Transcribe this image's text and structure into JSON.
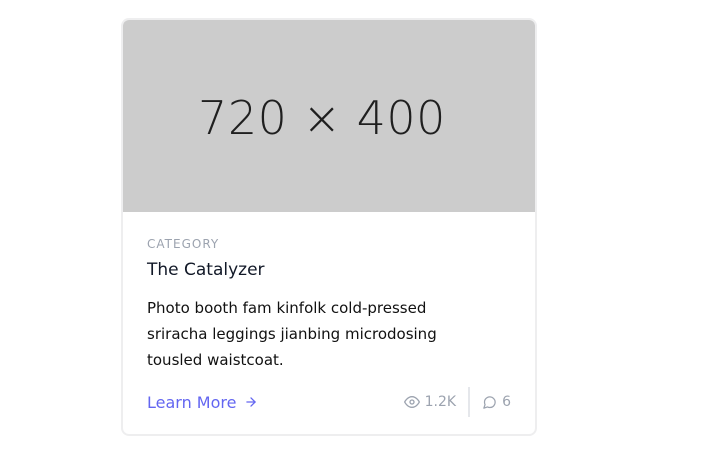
{
  "card": {
    "image": {
      "placeholder_text": "720 × 400",
      "background": "#cccccc"
    },
    "category": "CATEGORY",
    "title": "The Catalyzer",
    "description": "Photo booth fam kinfolk cold-pressed sriracha leggings jianbing microdosing tousled waistcoat.",
    "link": {
      "label": "Learn More",
      "icon": "arrow-right-icon",
      "color": "#6366f1"
    },
    "stats": {
      "views": {
        "icon": "eye-icon",
        "value": "1.2K"
      },
      "comments": {
        "icon": "comment-icon",
        "value": "6"
      }
    }
  }
}
